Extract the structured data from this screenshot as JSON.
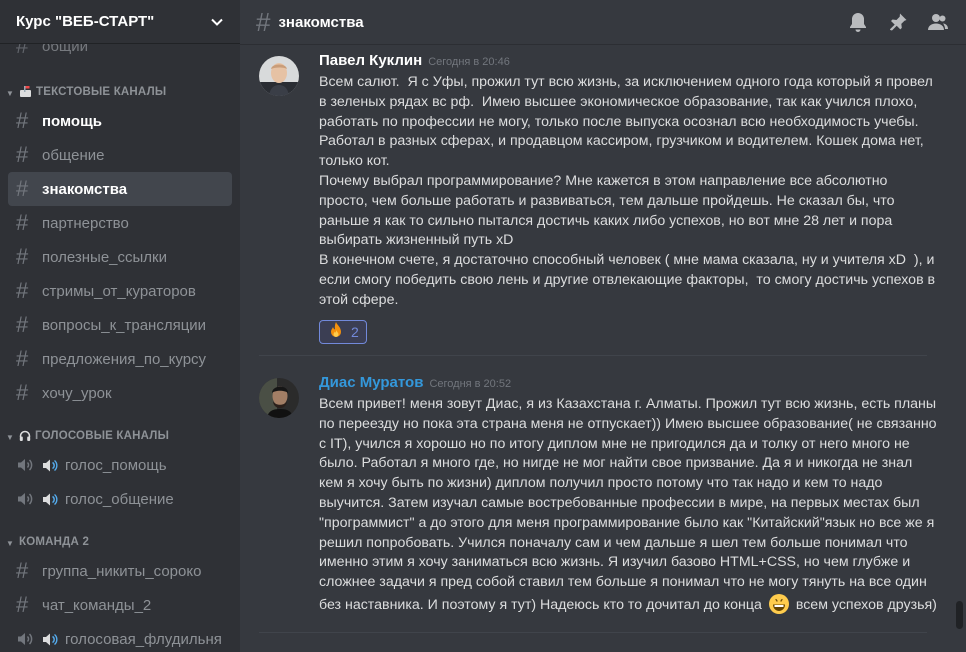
{
  "server": {
    "name": "Курс \"ВЕБ-СТАРТ\""
  },
  "sidebar": {
    "partial_channel": "общий",
    "categories": [
      {
        "name": "ТЕКСТОВЫЕ КАНАЛЫ"
      },
      {
        "name": "ГОЛОСОВЫЕ КАНАЛЫ"
      },
      {
        "name": "КОМАНДА 2"
      }
    ],
    "text_channels": [
      "помощь",
      "общение",
      "знакомства",
      "партнерство",
      "полезные_ссылки",
      "стримы_от_кураторов",
      "вопросы_к_трансляции",
      "предложения_по_курсу",
      "хочу_урок"
    ],
    "voice_channels": [
      "голос_помощь",
      "голос_общение"
    ],
    "team_channels": [
      "группа_никиты_сороко",
      "чат_команды_2",
      "голосовая_флудильня"
    ]
  },
  "channel": {
    "name": "знакомства"
  },
  "messages": [
    {
      "author": "Павел Куклин",
      "time": "Сегодня в 20:46",
      "text": "Всем салют.  Я с Уфы, прожил тут всю жизнь, за исключением одного года который я провел в зеленых рядах вс рф.  Имею высшее экономическое образование, так как учился плохо, работать по профессии не могу, только после выпуска осознал всю необходимость учебы. Работал в разных сферах, и продавцом кассиром, грузчиком и водителем. Кошек дома нет, только кот.\nПочему выбрал программирование? Мне кажется в этом направление все абсолютно просто, чем больше работать и развиваться, тем дальше пройдешь. Не сказал бы, что раньше я как то сильно пытался достичь каких либо успехов, но вот мне 28 лет и пора выбирать жизненный путь xD\nВ конечном счете, я достаточно способный человек ( мне мама сказала, ну и учителя xD  ), и если смогу победить свою лень и другие отвлекающие факторы,  то смогу достичь успехов в этой сфере.",
      "reaction": {
        "emoji": "fire-icon",
        "count": "2"
      }
    },
    {
      "author": "Диас Муратов",
      "time": "Сегодня в 20:52",
      "text": "Всем привет! меня зовут Диас, я из Казахстана г. Алматы. Прожил тут всю жизнь, есть планы по переезду но пока эта страна меня не отпускает)) Имею высшее образование( не связанно с IT), учился я хорошо но по итогу диплом мне не пригодился да и толку от него много не было. Работал я много где, но нигде не мог найти свое призвание. Да я и никогда не знал кем я хочу быть по жизни) диплом получил просто потому что так надо и кем то надо выучится. Затем изучал самые востребованные профессии в мире, на первых местах был \"программист\" а до этого для меня программирование было как \"Китайский\"язык но все же я решил попробовать. Учился поначалу сам и чем дальше я шел тем больше понимал что именно этим я хочу заниматься всю жизнь. Я изучил базово HTML+CSS, но чем глубже и сложнее задачи я пред собой ставил тем больше я понимал что не могу тянуть на все один без наставника. И поэтому я тут) Надеюсь кто то дочитал до конца",
      "text_tail": "всем успехов друзья)"
    }
  ],
  "colors": {
    "accent": "#7289da",
    "author2": "#3498db",
    "background": "#36393f",
    "sidebar": "#2f3136"
  }
}
